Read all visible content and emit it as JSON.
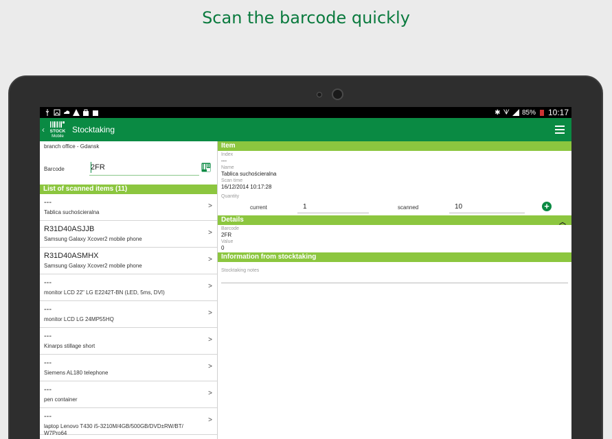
{
  "headline": "Scan the barcode quickly",
  "statusbar": {
    "battery": "85%",
    "time": "10:17"
  },
  "appbar": {
    "title": "Stocktaking",
    "logo_top": "STOCK",
    "logo_bottom": "Mobile"
  },
  "left": {
    "branch": "branch office - Gdansk",
    "barcode_label": "Barcode",
    "barcode_value": "2FR",
    "list_title": "List of scanned items (11)",
    "items": [
      {
        "code": "---",
        "name": "Tablica suchościeralna"
      },
      {
        "code": "R31D40ASJJB",
        "name": "Samsung Galaxy Xcover2 mobile phone"
      },
      {
        "code": "R31D40ASMHX",
        "name": "Samsung Galaxy Xcover2 mobile phone"
      },
      {
        "code": "---",
        "name": "monitor LCD 22\" LG E2242T-BN (LED, 5ms, DVI)"
      },
      {
        "code": "---",
        "name": "monitor LCD LG 24MP55HQ"
      },
      {
        "code": "---",
        "name": "Kinarps stillage short"
      },
      {
        "code": "---",
        "name": "Siemens AL180 telephone"
      },
      {
        "code": "---",
        "name": "pen container"
      },
      {
        "code": "---",
        "name": "laptop Lenovo T430 i5-3210M/4GB/500GB/DVD±RW/BT/ W7Pro64"
      }
    ],
    "arrow": ">"
  },
  "right": {
    "item_title": "Item",
    "index_label": "Index",
    "index_value": "---",
    "name_label": "Name",
    "name_value": "Tablica suchościeralna",
    "scan_time_label": "Scan time",
    "scan_time_value": "16/12/2014 10:17:28",
    "quantity_label": "Quantity",
    "current_label": "current",
    "current_value": "1",
    "scanned_label": "scanned",
    "scanned_value": "10",
    "details_title": "Details",
    "barcode_label": "Barcode",
    "barcode_value": "2FR",
    "value_label": "Value",
    "value_value": "0",
    "info_title": "Information from stocktaking",
    "notes_label": "Stocktaking notes"
  },
  "colors": {
    "brand_green": "#0a8a43",
    "section_green": "#8cc63f"
  }
}
